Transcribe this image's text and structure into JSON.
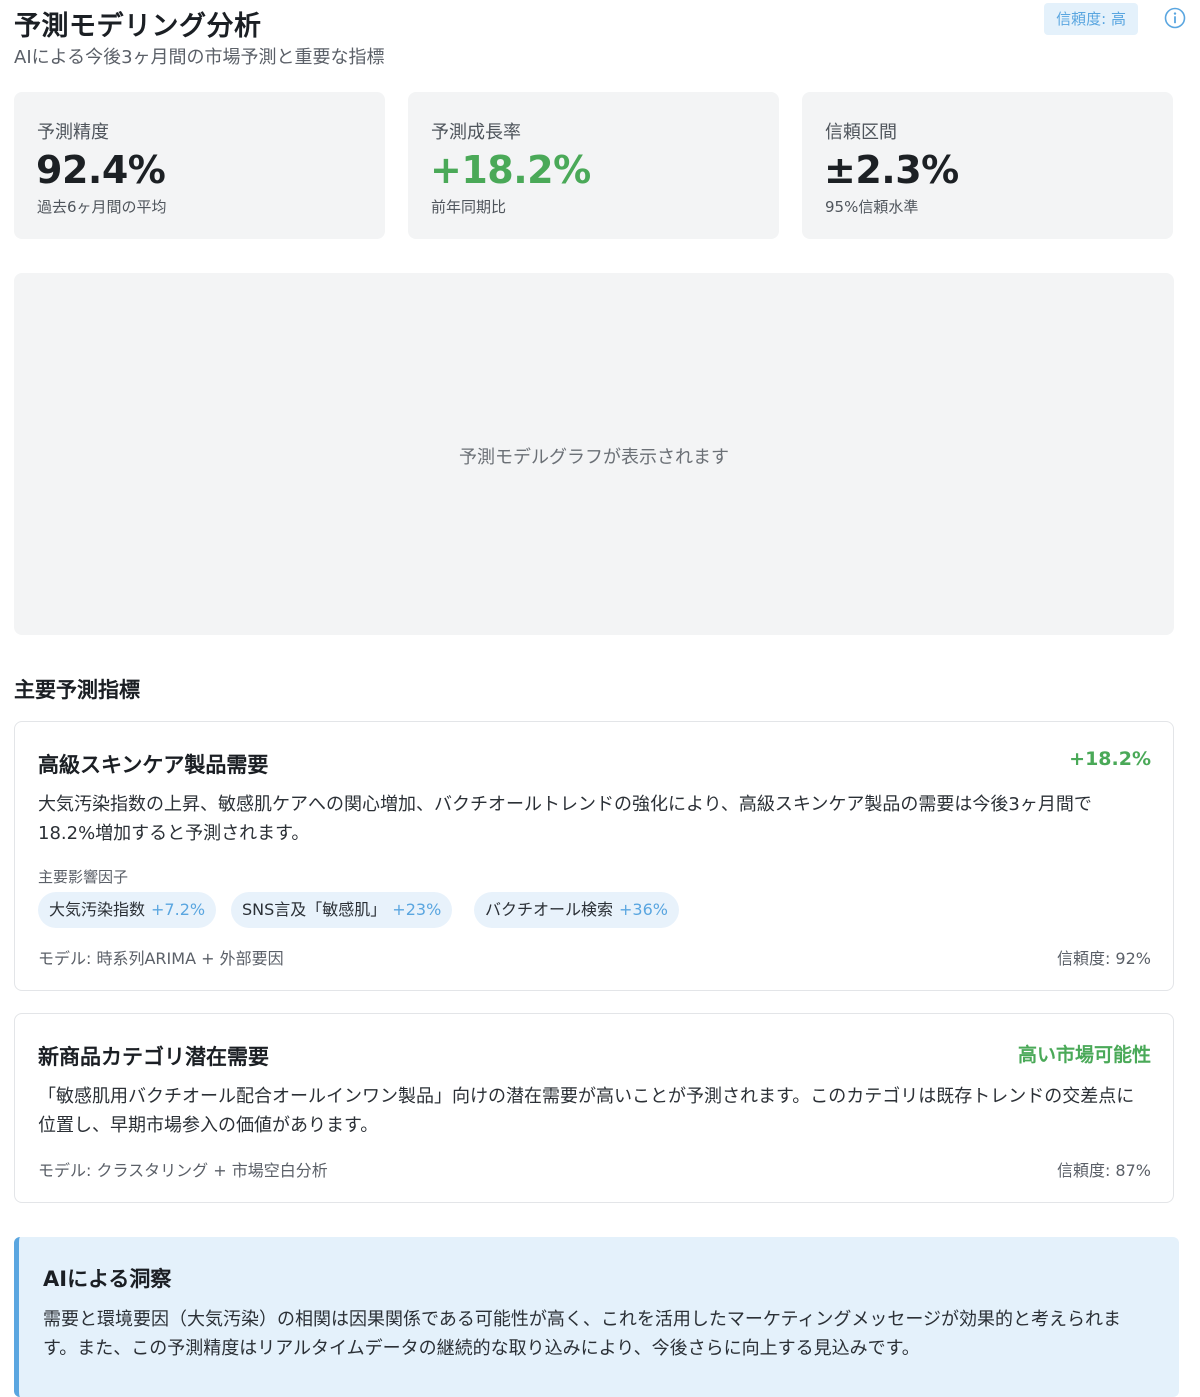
{
  "header": {
    "title": "予測モデリング分析",
    "subtitle": "AIによる今後3ヶ月間の市場予測と重要な指標",
    "confidence_badge": "信頼度: 高",
    "info_icon": "info-icon"
  },
  "stats": [
    {
      "label": "予測精度",
      "value": "92.4%",
      "sub": "過去6ヶ月間の平均"
    },
    {
      "label": "予測成長率",
      "value": "+18.2%",
      "sub": "前年同期比"
    },
    {
      "label": "信頼区間",
      "value": "±2.3%",
      "sub": "95%信頼水準"
    }
  ],
  "graph": {
    "placeholder": "予測モデルグラフが表示されます"
  },
  "section": {
    "title": "主要予測指標"
  },
  "indicators": [
    {
      "title": "高級スキンケア製品需要",
      "metric": "+18.2%",
      "description": "大気汚染指数の上昇、敏感肌ケアへの関心増加、バクチオールトレンドの強化により、高級スキンケア製品の需要は今後3ヶ月間で18.2%増加すると予測されます。",
      "factors_label": "主要影響因子",
      "factors": [
        {
          "name": "大気汚染指数",
          "delta": "+7.2%"
        },
        {
          "name": "SNS言及「敏感肌」",
          "delta": "+23%"
        },
        {
          "name": "バクチオール検索",
          "delta": "+36%"
        }
      ],
      "model": "モデル: 時系列ARIMA + 外部要因",
      "confidence": "信頼度: 92%"
    },
    {
      "title": "新商品カテゴリ潜在需要",
      "metric": "高い市場可能性",
      "description": "「敏感肌用バクチオール配合オールインワン製品」向けの潜在需要が高いことが予測されます。このカテゴリは既存トレンドの交差点に位置し、早期市場参入の価値があります。",
      "model": "モデル: クラスタリング + 市場空白分析",
      "confidence": "信頼度: 87%"
    }
  ],
  "insight": {
    "title": "AIによる洞察",
    "text": "需要と環境要因（大気汚染）の相関は因果関係である可能性が高く、これを活用したマーケティングメッセージが効果的と考えられます。また、この予測精度はリアルタイムデータの継続的な取り込みにより、今後さらに向上する見込みです。"
  },
  "colors": {
    "accent_blue": "#5aa6e0",
    "positive_green": "#4aa958",
    "card_bg": "#f3f4f5",
    "insight_bg": "#e4f1fb"
  }
}
